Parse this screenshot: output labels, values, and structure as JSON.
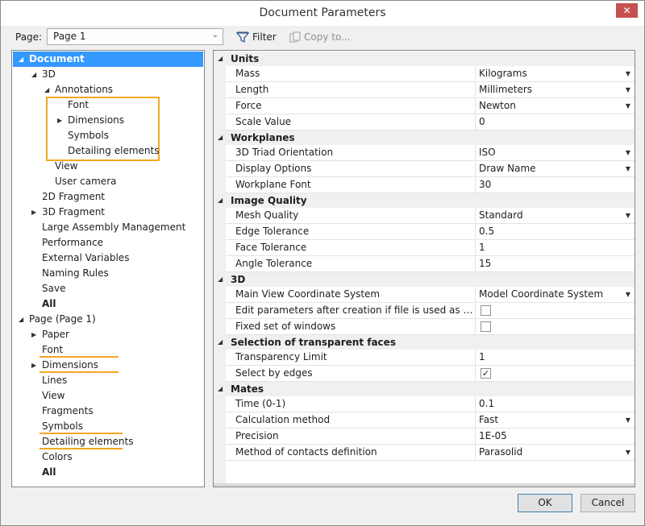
{
  "window": {
    "title": "Document Parameters",
    "close_label": "✕"
  },
  "toolbar": {
    "page_label": "Page:",
    "page_value": "Page 1",
    "filter_label": "Filter",
    "copy_label": "Copy to..."
  },
  "tree": [
    {
      "label": "Document",
      "indent": 0,
      "expander": "down",
      "style": "selected"
    },
    {
      "label": "3D",
      "indent": 1,
      "expander": "down",
      "style": ""
    },
    {
      "label": "Annotations",
      "indent": 2,
      "expander": "down",
      "style": ""
    },
    {
      "label": "Font",
      "indent": 3,
      "expander": "",
      "style": ""
    },
    {
      "label": "Dimensions",
      "indent": 3,
      "expander": "right",
      "style": ""
    },
    {
      "label": "Symbols",
      "indent": 3,
      "expander": "",
      "style": ""
    },
    {
      "label": "Detailing elements",
      "indent": 3,
      "expander": "",
      "style": ""
    },
    {
      "label": "View",
      "indent": 2,
      "expander": "",
      "style": ""
    },
    {
      "label": "User camera",
      "indent": 2,
      "expander": "",
      "style": ""
    },
    {
      "label": "2D Fragment",
      "indent": 1,
      "expander": "",
      "style": ""
    },
    {
      "label": "3D Fragment",
      "indent": 1,
      "expander": "right",
      "style": ""
    },
    {
      "label": "Large Assembly Management",
      "indent": 1,
      "expander": "",
      "style": ""
    },
    {
      "label": "Performance",
      "indent": 1,
      "expander": "",
      "style": ""
    },
    {
      "label": "External Variables",
      "indent": 1,
      "expander": "",
      "style": ""
    },
    {
      "label": "Naming Rules",
      "indent": 1,
      "expander": "",
      "style": ""
    },
    {
      "label": "Save",
      "indent": 1,
      "expander": "",
      "style": ""
    },
    {
      "label": "All",
      "indent": 1,
      "expander": "",
      "style": "bold"
    },
    {
      "label": "Page (Page 1)",
      "indent": 0,
      "expander": "down",
      "style": ""
    },
    {
      "label": "Paper",
      "indent": 1,
      "expander": "right",
      "style": ""
    },
    {
      "label": "Font",
      "indent": 1,
      "expander": "",
      "style": ""
    },
    {
      "label": "Dimensions",
      "indent": 1,
      "expander": "right",
      "style": ""
    },
    {
      "label": "Lines",
      "indent": 1,
      "expander": "",
      "style": ""
    },
    {
      "label": "View",
      "indent": 1,
      "expander": "",
      "style": ""
    },
    {
      "label": "Fragments",
      "indent": 1,
      "expander": "",
      "style": ""
    },
    {
      "label": "Symbols",
      "indent": 1,
      "expander": "",
      "style": ""
    },
    {
      "label": "Detailing elements",
      "indent": 1,
      "expander": "",
      "style": ""
    },
    {
      "label": "Colors",
      "indent": 1,
      "expander": "",
      "style": ""
    },
    {
      "label": "All",
      "indent": 1,
      "expander": "",
      "style": "bold"
    }
  ],
  "properties": [
    {
      "category": "Units",
      "rows": [
        {
          "name": "Mass",
          "value": "Kilograms",
          "type": "dropdown"
        },
        {
          "name": "Length",
          "value": "Millimeters",
          "type": "dropdown"
        },
        {
          "name": "Force",
          "value": "Newton",
          "type": "dropdown"
        },
        {
          "name": "Scale Value",
          "value": "0",
          "type": "text"
        }
      ]
    },
    {
      "category": "Workplanes",
      "rows": [
        {
          "name": "3D Triad Orientation",
          "value": "ISO",
          "type": "dropdown"
        },
        {
          "name": "Display Options",
          "value": "Draw Name",
          "type": "dropdown"
        },
        {
          "name": "Workplane Font",
          "value": "30",
          "type": "text"
        }
      ]
    },
    {
      "category": "Image Quality",
      "rows": [
        {
          "name": "Mesh Quality",
          "value": "Standard",
          "type": "dropdown"
        },
        {
          "name": "Edge Tolerance",
          "value": "0.5",
          "type": "text"
        },
        {
          "name": "Face Tolerance",
          "value": "1",
          "type": "text"
        },
        {
          "name": "Angle Tolerance",
          "value": "15",
          "type": "text"
        }
      ]
    },
    {
      "category": "3D",
      "rows": [
        {
          "name": "Main View Coordinate System",
          "value": "Model Coordinate System",
          "type": "dropdown"
        },
        {
          "name": "Edit parameters after creation if file is used as a template",
          "value": "",
          "type": "checkbox",
          "checked": false
        },
        {
          "name": "Fixed set of windows",
          "value": "",
          "type": "checkbox",
          "checked": false
        }
      ]
    },
    {
      "category": "Selection of transparent faces",
      "rows": [
        {
          "name": "Transparency Limit",
          "value": "1",
          "type": "text"
        },
        {
          "name": "Select by edges",
          "value": "",
          "type": "checkbox",
          "checked": true
        }
      ]
    },
    {
      "category": "Mates",
      "rows": [
        {
          "name": "Time (0-1)",
          "value": "0.1",
          "type": "text"
        },
        {
          "name": "Calculation method",
          "value": "Fast",
          "type": "dropdown"
        },
        {
          "name": "Precision",
          "value": "1E-05",
          "type": "text"
        },
        {
          "name": "Method of contacts definition",
          "value": "Parasolid",
          "type": "dropdown"
        }
      ]
    }
  ],
  "buttons": {
    "ok": "OK",
    "cancel": "Cancel"
  },
  "colors": {
    "selection": "#3399ff",
    "highlight": "#f5a623",
    "close": "#c75050"
  },
  "icons": {
    "filter": "filter-icon",
    "copy": "copy-icon",
    "close": "close-icon",
    "expand": "triangle-icon"
  }
}
